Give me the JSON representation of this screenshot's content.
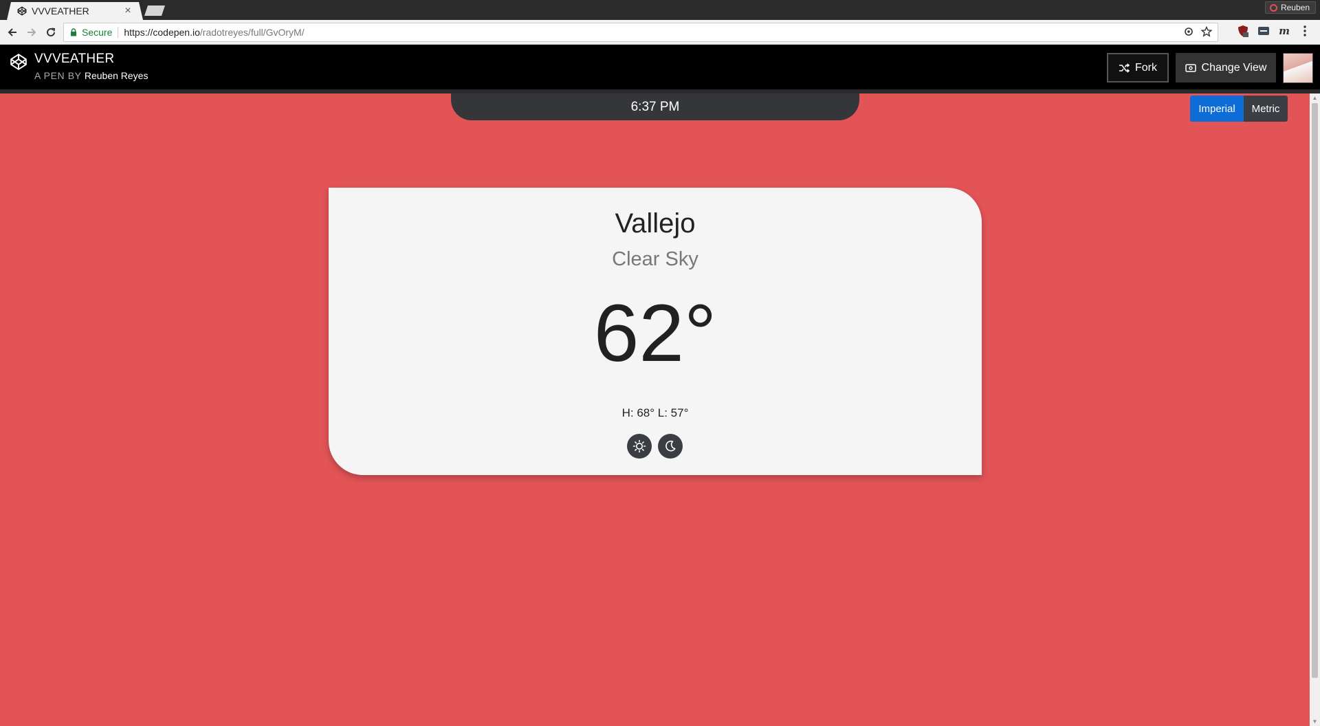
{
  "browser": {
    "tab_title": "VVVEATHER",
    "tab_close": "×",
    "profile_name": "Reuben",
    "secure_label": "Secure",
    "url_host": "https://codepen.io",
    "url_path": "/radotreyes/full/GvOryM/"
  },
  "codepen": {
    "pen_title": "VVVEATHER",
    "pen_by": "A PEN BY",
    "author": "Reuben Reyes",
    "fork_label": "Fork",
    "change_view_label": "Change View"
  },
  "weather": {
    "time": "6:37 PM",
    "units": {
      "imperial": "Imperial",
      "metric": "Metric",
      "selected": "Imperial"
    },
    "city": "Vallejo",
    "condition": "Clear Sky",
    "temperature": "62°",
    "high_low": "H: 68° L: 57°"
  },
  "colors": {
    "background": "#e35457",
    "card": "#f5f5f5",
    "accent_blue": "#0d6cd6",
    "dark": "#34363a"
  },
  "icons": {
    "light_theme": "sun-icon",
    "dark_theme": "moon-icon"
  }
}
